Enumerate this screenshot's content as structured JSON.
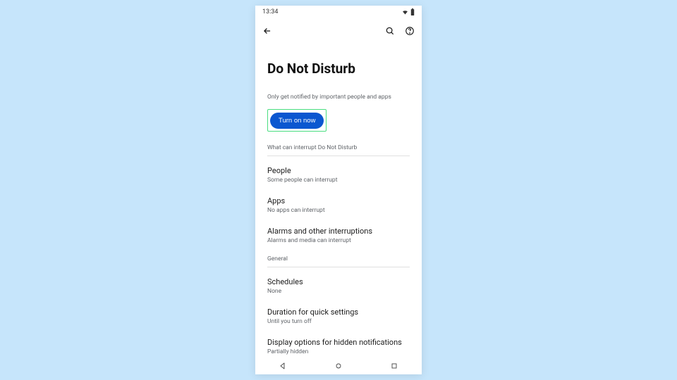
{
  "statusbar": {
    "time": "13:34"
  },
  "page": {
    "title": "Do Not Disturb",
    "subtitle": "Only get notified by important people and apps",
    "toggle_button": "Turn on now"
  },
  "sections": {
    "interrupt": {
      "header": "What can interrupt Do Not Disturb",
      "items": [
        {
          "title": "People",
          "sub": "Some people can interrupt"
        },
        {
          "title": "Apps",
          "sub": "No apps can interrupt"
        },
        {
          "title": "Alarms and other interruptions",
          "sub": "Alarms and media can interrupt"
        }
      ]
    },
    "general": {
      "header": "General",
      "items": [
        {
          "title": "Schedules",
          "sub": "None"
        },
        {
          "title": "Duration for quick settings",
          "sub": "Until you turn off"
        },
        {
          "title": "Display options for hidden notifications",
          "sub": "Partially hidden"
        }
      ]
    }
  }
}
